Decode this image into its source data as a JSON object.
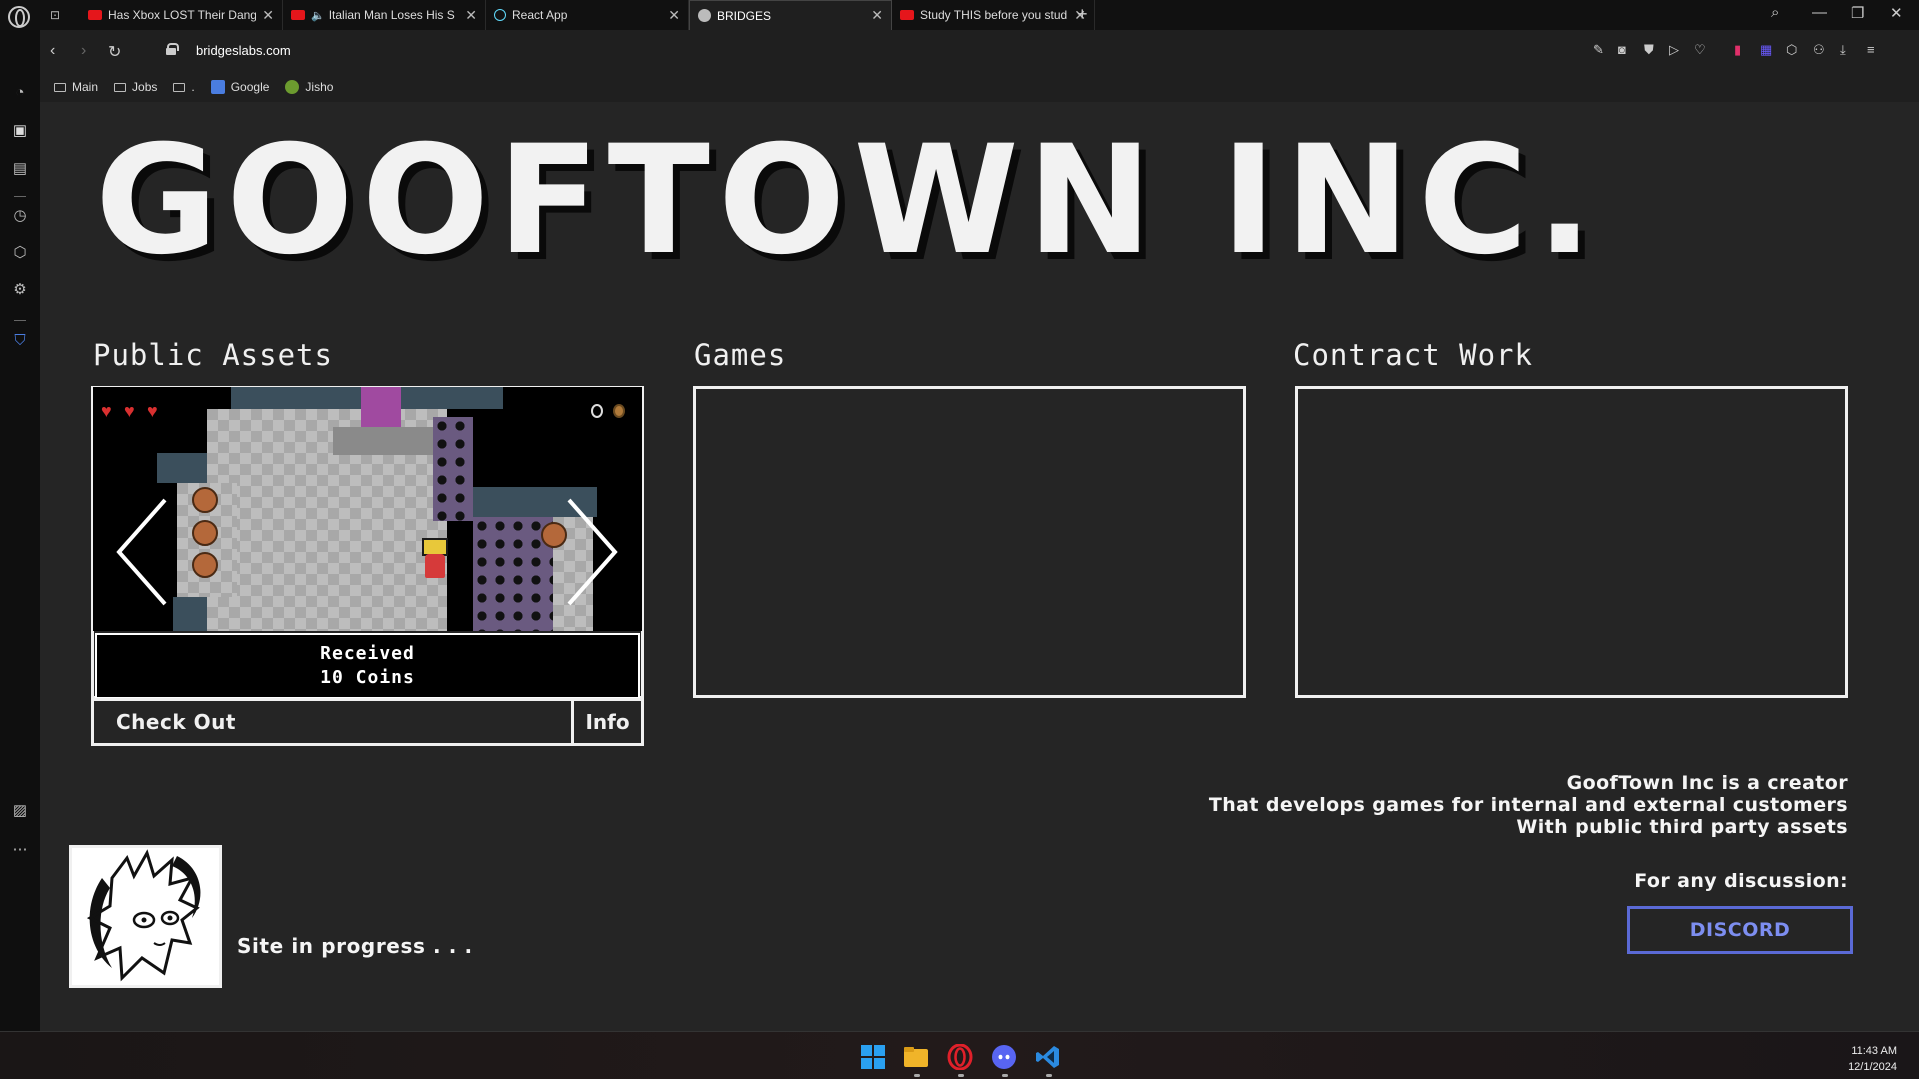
{
  "browser": {
    "tabs": [
      {
        "title": "Has Xbox LOST Their Dang",
        "icon": "youtube-icon",
        "active": false
      },
      {
        "title": "Italian Man Loses His S",
        "icon": "youtube-icon",
        "active": false,
        "audio": true
      },
      {
        "title": "React App",
        "icon": "react-icon",
        "active": false
      },
      {
        "title": "BRIDGES",
        "icon": "site-icon",
        "active": true
      },
      {
        "title": "Study THIS before you stud",
        "icon": "youtube-icon",
        "active": false
      }
    ],
    "url": "bridgeslabs.com",
    "bookmarks": [
      {
        "label": "Main",
        "icon": "folder-icon"
      },
      {
        "label": "Jobs",
        "icon": "folder-icon"
      },
      {
        "label": ".",
        "icon": "folder-icon"
      },
      {
        "label": "Google",
        "icon": "google-icon"
      },
      {
        "label": "Jisho",
        "icon": "jisho-icon"
      }
    ]
  },
  "site": {
    "title": "GOOFTOWN INC.",
    "sections": {
      "assets": "Public Assets",
      "games": "Games",
      "contract": "Contract Work"
    },
    "game_dialog": {
      "line1": "Received",
      "line2": "10 Coins"
    },
    "check_out": "Check Out",
    "info": "Info",
    "about": {
      "line1": "GoofTown Inc is a creator",
      "line2": "That develops  games for internal and external customers",
      "line3": "With public third party assets"
    },
    "discussion": "For any discussion:",
    "discord": "DISCORD",
    "progress": "Site in progress . . ."
  },
  "taskbar": {
    "time": "11:43 AM",
    "date": "12/1/2024"
  },
  "colors": {
    "page_bg": "#252525",
    "accent_discord": "#5b6ad6",
    "title": "#f2f2f2"
  }
}
